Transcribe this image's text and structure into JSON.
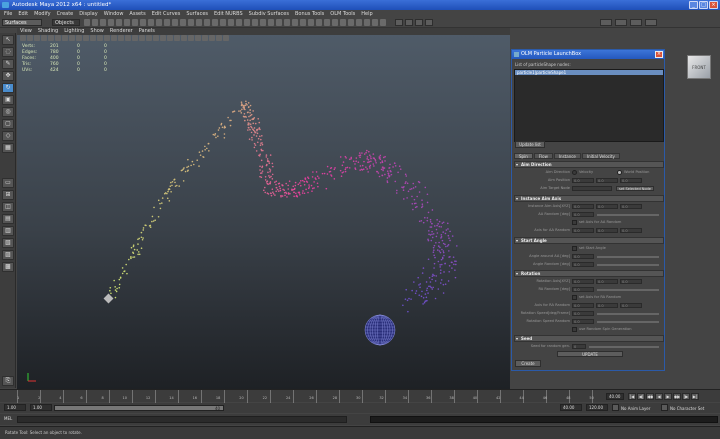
{
  "window": {
    "title": "Autodesk Maya 2012 x64 : untitled*"
  },
  "menus": [
    "File",
    "Edit",
    "Modify",
    "Create",
    "Display",
    "Window",
    "Assets",
    "Edit Curves",
    "Surfaces",
    "Edit NURBS",
    "Subdiv Surfaces",
    "Bonus Tools",
    "OLM Tools",
    "Help"
  ],
  "statusline": {
    "mode": "Surfaces",
    "objects_label": "Objects"
  },
  "panel_menus": [
    "View",
    "Shading",
    "Lighting",
    "Show",
    "Renderer",
    "Panels"
  ],
  "hud": [
    {
      "label": "Verts:",
      "a": "201",
      "b": "0",
      "c": "0"
    },
    {
      "label": "Edges:",
      "a": "780",
      "b": "0",
      "c": "0"
    },
    {
      "label": "Faces:",
      "a": "400",
      "b": "0",
      "c": "0"
    },
    {
      "label": "Tris:",
      "a": "760",
      "b": "0",
      "c": "0"
    },
    {
      "label": "UVs:",
      "a": "424",
      "b": "0",
      "c": "0"
    }
  ],
  "viewcube": {
    "label": "FRONT"
  },
  "colors": {
    "accent": "#3c75d8",
    "particles_start": "#c8e070",
    "particles_mid": "#e0409a",
    "particles_end": "#6a50c8"
  },
  "dialog": {
    "title": "OLM Particle LaunchBox",
    "list_label": "List of particleShape nodes:",
    "list_selected": "particle1|particleShape1",
    "update_button": "Update list",
    "tabs": [
      "Spin",
      "Flow",
      "Instance",
      "Initial Velocity"
    ],
    "sections": {
      "aim_direction": {
        "title": "Aim Direction",
        "velocity_label": "Velocity",
        "world_position_label": "World Position",
        "aim_direction_label": "Aim Direction",
        "aim_position_label": "Aim Position",
        "aim_position_value": "0.0",
        "aim_target_label": "Aim Target Node",
        "set_selected_button": "set Selected Node"
      },
      "instance_aim_axis": {
        "title": "Instance Aim Axis",
        "instance_aim_axis_label": "Instance Aim Axis[XYZ]",
        "instance_aim_axis_value": "0.0",
        "aa_random_label": "AA Random [deg]",
        "aa_random_value": "0.0",
        "set_axis_random_label": "set Axis for AA Random",
        "axis_for_random_label": "Axis for AA Random",
        "axis_for_random_value": "0.0"
      },
      "start_angle": {
        "title": "Start Angle",
        "set_start_angle_label": "set Start Angle",
        "angle_around_label": "Angle around AA [deg]",
        "angle_around_value": "0.0",
        "angle_random_label": "Angle Random [deg]",
        "angle_random_value": "0.0"
      },
      "rotation": {
        "title": "Rotation",
        "rotation_axis_label": "Rotation Axis[XYZ]",
        "rotation_axis_value": "0.0",
        "ra_random_label": "RA Random [deg]",
        "ra_random_value": "0.0",
        "set_axis_ra_label": "set Axis for RA Random",
        "axis_ra_label": "Axis for RA Random",
        "axis_ra_value": "0.0",
        "rotation_speed_label": "Rotation Speed[deg/Frame]",
        "rotation_speed_value": "0.0",
        "rotation_speed_random_label": "Rotation Speed Random",
        "rotation_speed_random_value": "0.0",
        "use_random_spin_label": "use Random Spin Generation"
      },
      "seed": {
        "title": "Seed",
        "seed_label": "Seed for random gen.",
        "seed_value": "0",
        "update_seed_button": "UPDATE"
      }
    },
    "create_button": "Create"
  },
  "timeline": {
    "ticks": [
      "1",
      "2",
      "4",
      "6",
      "8",
      "10",
      "12",
      "14",
      "16",
      "18",
      "20",
      "22",
      "24",
      "26",
      "28",
      "30",
      "32",
      "34",
      "36",
      "38",
      "40",
      "42",
      "44",
      "46",
      "48",
      "50"
    ],
    "current_frame": "40.00"
  },
  "range": {
    "start": "1.00",
    "playback_start": "1.00",
    "range_label": "40",
    "playback_end": "40.00",
    "end": "120.00",
    "anim_layer": "No Anim Layer",
    "character_set": "No Character Set"
  },
  "command": {
    "mel_label": "MEL"
  },
  "help_line": "Rotate Tool: Select an object to rotate."
}
